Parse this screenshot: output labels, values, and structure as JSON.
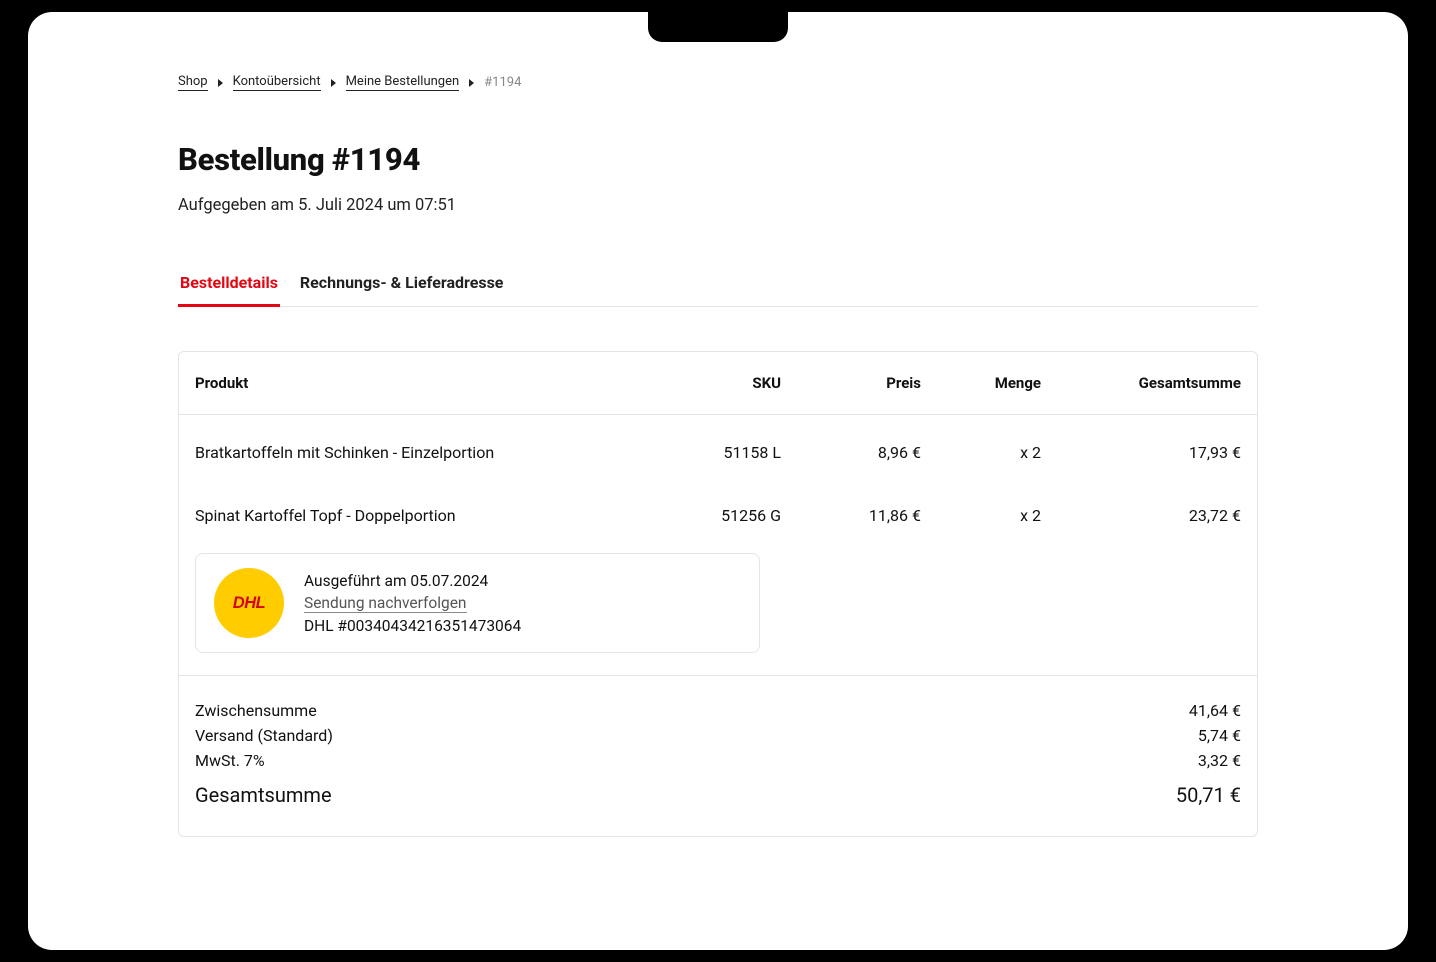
{
  "breadcrumb": {
    "shop": "Shop",
    "account": "Kontoübersicht",
    "orders": "Meine Bestellungen",
    "current": "#1194"
  },
  "header": {
    "title": "Bestellung #1194",
    "date_line": "Aufgegeben am 5. Juli 2024 um 07:51"
  },
  "tabs": {
    "details": "Bestelldetails",
    "address": "Rechnungs- & Lieferadresse"
  },
  "table": {
    "columns": {
      "product": "Produkt",
      "sku": "SKU",
      "price": "Preis",
      "qty": "Menge",
      "total": "Gesamtsumme"
    },
    "rows": [
      {
        "product": "Bratkartoffeln mit Schinken - Einzelportion",
        "sku": "51158 L",
        "price": "8,96 €",
        "qty": "x 2",
        "total": "17,93 €"
      },
      {
        "product": "Spinat Kartoffel Topf - Doppelportion",
        "sku": "51256 G",
        "price": "11,86 €",
        "qty": "x 2",
        "total": "23,72 €"
      }
    ]
  },
  "shipment": {
    "carrier_badge": "DHL",
    "fulfilled": "Ausgeführt am 05.07.2024",
    "track_label": "Sendung nachverfolgen",
    "tracking": "DHL #00340434216351473064"
  },
  "totals": {
    "subtotal_label": "Zwischensumme",
    "subtotal_value": "41,64 €",
    "shipping_label": "Versand (Standard)",
    "shipping_value": "5,74 €",
    "tax_label": "MwSt. 7%",
    "tax_value": "3,32 €",
    "grand_label": "Gesamtsumme",
    "grand_value": "50,71 €"
  }
}
